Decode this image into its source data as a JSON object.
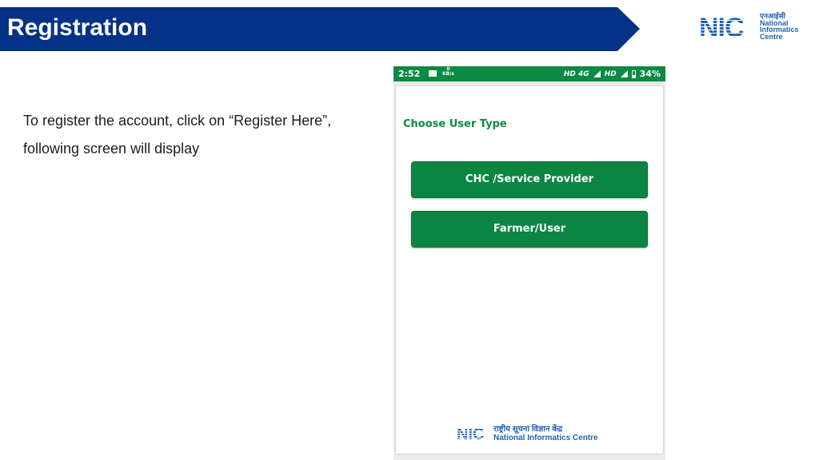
{
  "slide": {
    "title": "Registration",
    "description_line1": "To register the account, click on “Register Here”,",
    "description_line2": "following screen will display"
  },
  "header_logo": {
    "letters": "NIC",
    "hindi": "एनआईसी",
    "line1": "National",
    "line2": "Informatics",
    "line3": "Centre",
    "color": "#1e64b4"
  },
  "phone": {
    "status_bar": {
      "time": "2:52",
      "image_icon": "image-icon",
      "speed_value": "0",
      "speed_unit": "KB/s",
      "network1": "HD 4G",
      "network2": "HD",
      "battery": "34%",
      "color": "#0a8a43"
    },
    "screen": {
      "label": "Choose User Type",
      "buttons": [
        {
          "label": "CHC /Service Provider"
        },
        {
          "label": "Farmer/User"
        }
      ],
      "accent_color": "#0b8642"
    },
    "footer_logo": {
      "letters": "NIC",
      "hindi": "राष्ट्रीय सूचना विज्ञान केंद्र",
      "english": "National Informatics Centre"
    }
  },
  "colors": {
    "banner": "#053287"
  }
}
